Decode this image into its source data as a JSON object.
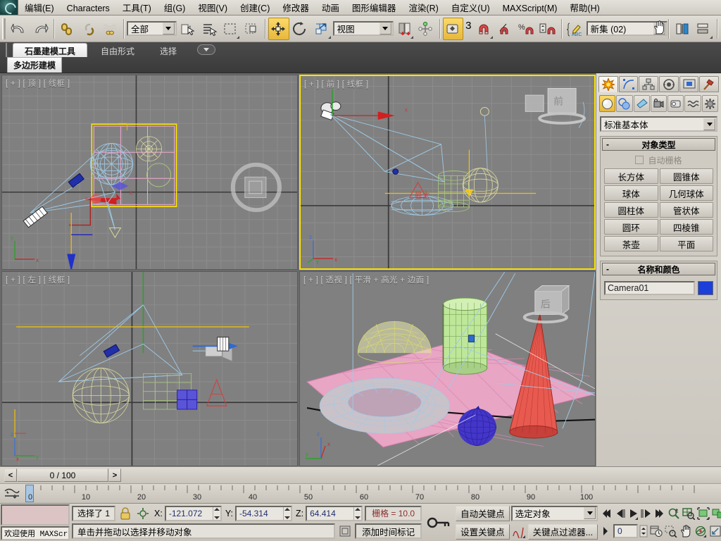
{
  "app": {
    "title": "3ds Max"
  },
  "menu": {
    "items": [
      "编辑(E)",
      "Characters",
      "工具(T)",
      "组(G)",
      "视图(V)",
      "创建(C)",
      "修改器",
      "动画",
      "图形编辑器",
      "渲染(R)",
      "自定义(U)",
      "MAXScript(M)",
      "帮助(H)"
    ]
  },
  "toolbar": {
    "undo": "撤消",
    "redo": "重做",
    "select_link": "选择并链接",
    "unlink": "断开当前选择链接",
    "bind_space_warp": "绑定到空间扭曲",
    "selection_filter_value": "全部",
    "select_object": "选择对象",
    "select_by_name": "按名称选择",
    "rect_select_region": "矩形选择区域",
    "window_crossing": "窗口/交叉",
    "select_and_move": "选择并移动",
    "select_and_rotate": "选择并旋转",
    "select_and_scale": "选择并均匀缩放",
    "reference_coord_value": "视图",
    "use_pivot_center": "使用轴点中心",
    "select_and_manipulate": "选择并操纵",
    "snap_toggle_label": "3",
    "snaps_toggle": "捕捉开关",
    "angle_snap": "角度捕捉切换",
    "percent_snap": "百分比捕捉切换",
    "spinner_snap": "微调器捕捉切换",
    "named_selection_sets": "命名选择集",
    "named_set_value": "新集 (02)",
    "mirror": "镜像",
    "align": "对齐"
  },
  "ribbon": {
    "tabs": [
      {
        "label": "石墨建模工具",
        "active": true
      },
      {
        "label": "自由形式",
        "active": false
      },
      {
        "label": "选择",
        "active": false
      }
    ],
    "overflow_icon": "chevron-down-icon",
    "subtab": "多边形建模"
  },
  "viewports": [
    {
      "name": "top",
      "prefix": "[ + ]",
      "view": "[ 顶 ]",
      "shading": "[ 线框 ]",
      "active": false
    },
    {
      "name": "front",
      "prefix": "[ + ]",
      "view": "[ 前 ]",
      "shading": "[ 线框 ]",
      "active": true
    },
    {
      "name": "left",
      "prefix": "[ + ]",
      "view": "[ 左 ]",
      "shading": "[ 线框 ]",
      "active": false
    },
    {
      "name": "perspective",
      "prefix": "[ + ]",
      "view": "[ 透视 ]",
      "shading": "[ 平滑 + 高光 + 边面 ]",
      "active": false
    }
  ],
  "command_panel": {
    "tabs": [
      "create-tab",
      "modify-tab",
      "hierarchy-tab",
      "motion-tab",
      "display-tab",
      "utilities-tab"
    ],
    "category_buttons": [
      "geometry-button",
      "shapes-button",
      "lights-button",
      "cameras-button",
      "helpers-button",
      "space-warps-button",
      "systems-button"
    ],
    "subcategory_value": "标准基本体",
    "rollouts": [
      {
        "title": "对象类型",
        "minus": "-",
        "autogrid_label": "自动栅格",
        "object_buttons": [
          "长方体",
          "圆锥体",
          "球体",
          "几何球体",
          "圆柱体",
          "管状体",
          "圆环",
          "四棱锥",
          "茶壶",
          "平面"
        ]
      },
      {
        "title": "名称和颜色",
        "minus": "-",
        "name_value": "Camera01",
        "color_hex": "#1b3fd8"
      }
    ]
  },
  "time_slider": {
    "prev_label": "<",
    "next_label": ">",
    "current": "0 / 100"
  },
  "track_bar": {
    "ticks": [
      0,
      10,
      20,
      30,
      40,
      50,
      60,
      70,
      80,
      90,
      100
    ],
    "playhead_frame": 0
  },
  "status_bar": {
    "maxscript_prompt": "欢迎使用 MAXScript",
    "selection_count": "选择了 1",
    "lock_icon": "lock-icon",
    "coord_icon": "absolute-mode-icon",
    "x_label": "X:",
    "x_value": "-121.072",
    "y_label": "Y:",
    "y_value": "-54.314",
    "z_label": "Z:",
    "z_value": "64.414",
    "grid_text": "栅格 = 10.0",
    "prompt_text": "单击并拖动以选择并移动对象",
    "add_time_tag": "添加时间标记",
    "key_mode_icon": "key-icon",
    "auto_key": "自动关键点",
    "set_key": "设置关键点",
    "key_filter_target": "选定对象",
    "key_filters": "关键点过滤器...",
    "frame_field": "0"
  },
  "nav_controls": {
    "row1": [
      "go-to-start-icon",
      "previous-frame-icon",
      "play-animation-icon",
      "next-frame-icon",
      "go-to-end-icon",
      "zoom-icon",
      "zoom-all-icon",
      "zoom-extents-icon",
      "zoom-extents-all-icon"
    ],
    "row2": [
      "key-mode-toggle-icon",
      "frame-field",
      "time-configuration-icon",
      "zoom-region-icon",
      "pan-view-icon",
      "orbit-icon",
      "maximize-viewport-toggle-icon"
    ]
  },
  "colors": {
    "accent_yellow": "#ffe400",
    "viewport_gray": "#808080",
    "panel_gray": "#d4d0c8",
    "ribbon_dark": "#3f3f3f",
    "ground_pink": "#e8a5c4",
    "cylinder_green": "#bfe79a",
    "cone_red": "#e8594f",
    "sphere_blue": "#4336c8",
    "dome_yellow": "#e8e7b0"
  }
}
